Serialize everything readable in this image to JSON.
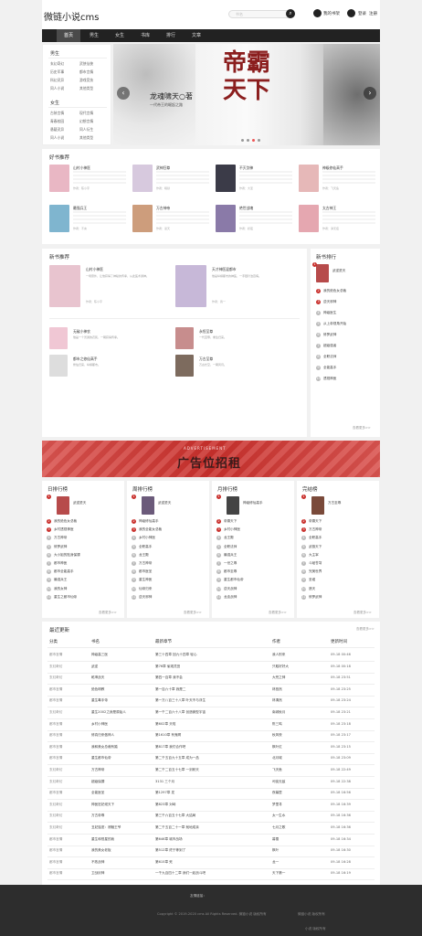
{
  "header": {
    "logo": "微链小说cms",
    "search_placeholder": "书名",
    "links": [
      "我的书架",
      "登录",
      "注册"
    ]
  },
  "nav": [
    "首页",
    "男生",
    "女生",
    "书库",
    "排行",
    "文章"
  ],
  "sidebar": {
    "groups": [
      {
        "title": "男生",
        "items": [
          "玄幻奇幻",
          "武侠仙侠",
          "历史军事",
          "都市言情",
          "科幻灵异",
          "游戏竞技",
          "同人小说",
          "其他类型"
        ]
      },
      {
        "title": "女生",
        "items": [
          "古装言情",
          "现代言情",
          "青春校园",
          "幻想言情",
          "悬疑灵异",
          "同人衍生",
          "同人小说",
          "其他类型"
        ]
      }
    ]
  },
  "banner": {
    "title": "帝霸天下",
    "author": "龙魂啸天○著",
    "sub": "一代帝王的崛起之路"
  },
  "recommend": {
    "title": "好书推荐",
    "books": [
      {
        "name": "山村小神医",
        "meta": "作者：陈小宇",
        "color": "#e9b7c4"
      },
      {
        "name": "武神狂尊",
        "meta": "作者：暗狱",
        "color": "#d7c9de"
      },
      {
        "name": "不灭剑神",
        "meta": "作者：大圣",
        "color": "#3b3b48"
      },
      {
        "name": "神级修仙高手",
        "meta": "作者：飞天鱼",
        "color": "#e6b8b8"
      },
      {
        "name": "最强兵王",
        "meta": "作者：不言",
        "color": "#7fb5cf"
      },
      {
        "name": "万古神帝",
        "meta": "作者：蓝天",
        "color": "#cd9d7c"
      },
      {
        "name": "绝世战魂",
        "meta": "作者：妖夜",
        "color": "#8a7aa8"
      },
      {
        "name": "太古神王",
        "meta": "作者：净无痕",
        "color": "#e5a7b0"
      }
    ]
  },
  "newbooks": {
    "title": "新书推荐",
    "top": [
      {
        "name": "山村小神医",
        "meta": "作者：陈小宇",
        "desc": "一场意外，让他获得了神秘的传承，从此医术通神。",
        "color": "#e8c4cf"
      },
      {
        "name": "天才神医混都市",
        "meta": "作者：我一",
        "desc": "他是纵横都市的神医，一手银针治百病。",
        "color": "#c7b8d8"
      }
    ],
    "rows": [
      {
        "name": "无敌小神农",
        "desc": "他是一个普通的农民，一朝获得传承。",
        "color": "#f0c7d4"
      },
      {
        "name": "永恒至尊",
        "desc": "一代至尊，重生归来。",
        "color": "#c78d8d"
      },
      {
        "name": "都市之修仙高手",
        "desc": "修仙归来，纵横都市。",
        "color": "#ddd"
      },
      {
        "name": "万古至尊",
        "desc": "万古长空，一朝风月。",
        "color": "#7d6b5e"
      }
    ]
  },
  "newrank": {
    "title": "新书排行",
    "top": "武逆焚天",
    "items": [
      "我的绝色女总裁",
      "逆天邪神",
      "神级医生",
      "从上帝视角开始",
      "修罗武神",
      "超级强者",
      "全职法师",
      "全能高手",
      "透视神医"
    ],
    "more": "查看更多>>"
  },
  "ad": {
    "text": "广告位招租",
    "sub": "ADVERTISEMENT"
  },
  "ranks": [
    {
      "title": "日排行榜",
      "top": "武逆焚天",
      "items": [
        "我的绝色女总裁",
        "乡村透视神医",
        "万古神帝",
        "修罗武神",
        "大小姐的贴身保镖",
        "都市神医",
        "都市全能高手",
        "最强兵王",
        "我的女神",
        "重生之都市仙帝"
      ]
    },
    {
      "title": "周排行榜",
      "top": "武逆焚天",
      "items": [
        "神级修仙高手",
        "我的全能女总裁",
        "乡村小神医",
        "全职高手",
        "龙王殿",
        "万古神帝",
        "都市医圣",
        "重生神医",
        "仙帝归来",
        "逆天邪神"
      ]
    },
    {
      "title": "月排行榜",
      "top": "神级修仙高手",
      "items": [
        "帝霸天下",
        "乡村小神医",
        "龙王殿",
        "全职法师",
        "最强兵王",
        "一世之尊",
        "都市至尊",
        "重生都市仙帝",
        "逆天战神",
        "龙血战神"
      ]
    },
    {
      "title": "完结榜",
      "top": "万古至尊",
      "items": [
        "帝霸天下",
        "万古神帝",
        "全职高手",
        "武极天下",
        "大主宰",
        "斗破苍穹",
        "完美世界",
        "圣墟",
        "遮天",
        "修罗武神"
      ]
    }
  ],
  "rank_more": "查看更多>>",
  "latest": {
    "title": "最近更新",
    "more": "查看更多>>",
    "headers": [
      "分类",
      "书名",
      "最新章节",
      "作者",
      "更新时间"
    ],
    "rows": [
      [
        "都市言情",
        "神级高三医",
        "第三十四章 回九十四章 轻心",
        "我人别来",
        "09-18 00:46"
      ],
      [
        "玄幻奇幻",
        "武逆",
        "第76章 偷观灵田",
        "只取好好大",
        "09-18 00:18"
      ],
      [
        "玄幻奇幻",
        "乾坤战天",
        "第四一百章 我不会",
        "大荒之神",
        "09-18 23:51"
      ],
      [
        "都市言情",
        "绝色明教",
        "第一百六十章 我是二",
        "林悠然",
        "09-18 23:25"
      ],
      [
        "都市言情",
        "重生毒手帝",
        "第一万八百三十八章 叶天不与浮生",
        "林清然",
        "09-18 23:24"
      ],
      [
        "玄幻奇幻",
        "重生2002之我是原始人",
        "第一千二百六十八章 创造微型宇宙",
        "南城秋月",
        "09-18 23:21"
      ],
      [
        "都市言情",
        "乡村小神医",
        "第602章 天啦",
        "陈三鸣",
        "09-18 23:18"
      ],
      [
        "都市言情",
        "修真归来做神人",
        "第1610章 有鬼啊",
        "秋风夜",
        "09-18 23:17"
      ],
      [
        "都市言情",
        "我和美女总裁有婚",
        "第817章 我们合作吧",
        "枫叶红",
        "09-18 23:15"
      ],
      [
        "都市言情",
        "重生都市仙帝",
        "第二千五百九十五章 成为一品",
        "北月城",
        "09-18 23:09"
      ],
      [
        "玄幻奇幻",
        "万古神帝",
        "第二千二百五十七章 一剑斩天",
        "飞天鱼",
        "09-18 22:49"
      ],
      [
        "玄幻奇幻",
        "超级保镖",
        "3131 三个月",
        "司徒无敌",
        "09-18 22:38"
      ],
      [
        "都市言情",
        "全能医圣",
        "第1297章 发",
        "夜幕里",
        "09-18 16:56"
      ],
      [
        "玄幻奇幻",
        "神医狂妃倾天下",
        "第823章 对峙",
        "梦里寻",
        "09-18 16:39"
      ],
      [
        "玄幻奇幻",
        "万古帝尊",
        "第三千六百五十七章 大结局",
        "太一生水",
        "09-18 16:36"
      ],
      [
        "玄幻奇幻",
        "丑妃独宠：邪魅王爷",
        "第二千五百二十一章 就地成亲",
        "七月之歌",
        "09-18 16:36"
      ],
      [
        "都市言情",
        "重生和恒星的我",
        "第646章 城市战场",
        "暮雪",
        "09-18 16:34"
      ],
      [
        "都市言情",
        "我的美女老板",
        "第512章 终于等到了",
        "枫叶",
        "09-18 16:30"
      ],
      [
        "都市言情",
        "不败战神",
        "第615章 死",
        "龙一",
        "09-18 16:28"
      ],
      [
        "都市言情",
        "卫战剑神",
        "一千九百四十二章 我们一起战斗吧",
        "天下第一",
        "09-18 16:19"
      ]
    ]
  },
  "footer": {
    "title": "友情链接：",
    "copyright": "Copyright © 2019-2020 cms All Rights Reserved. 微链小说 版权所有",
    "links": "微链小说 版权所有",
    "extra": "小说 版权所有"
  }
}
